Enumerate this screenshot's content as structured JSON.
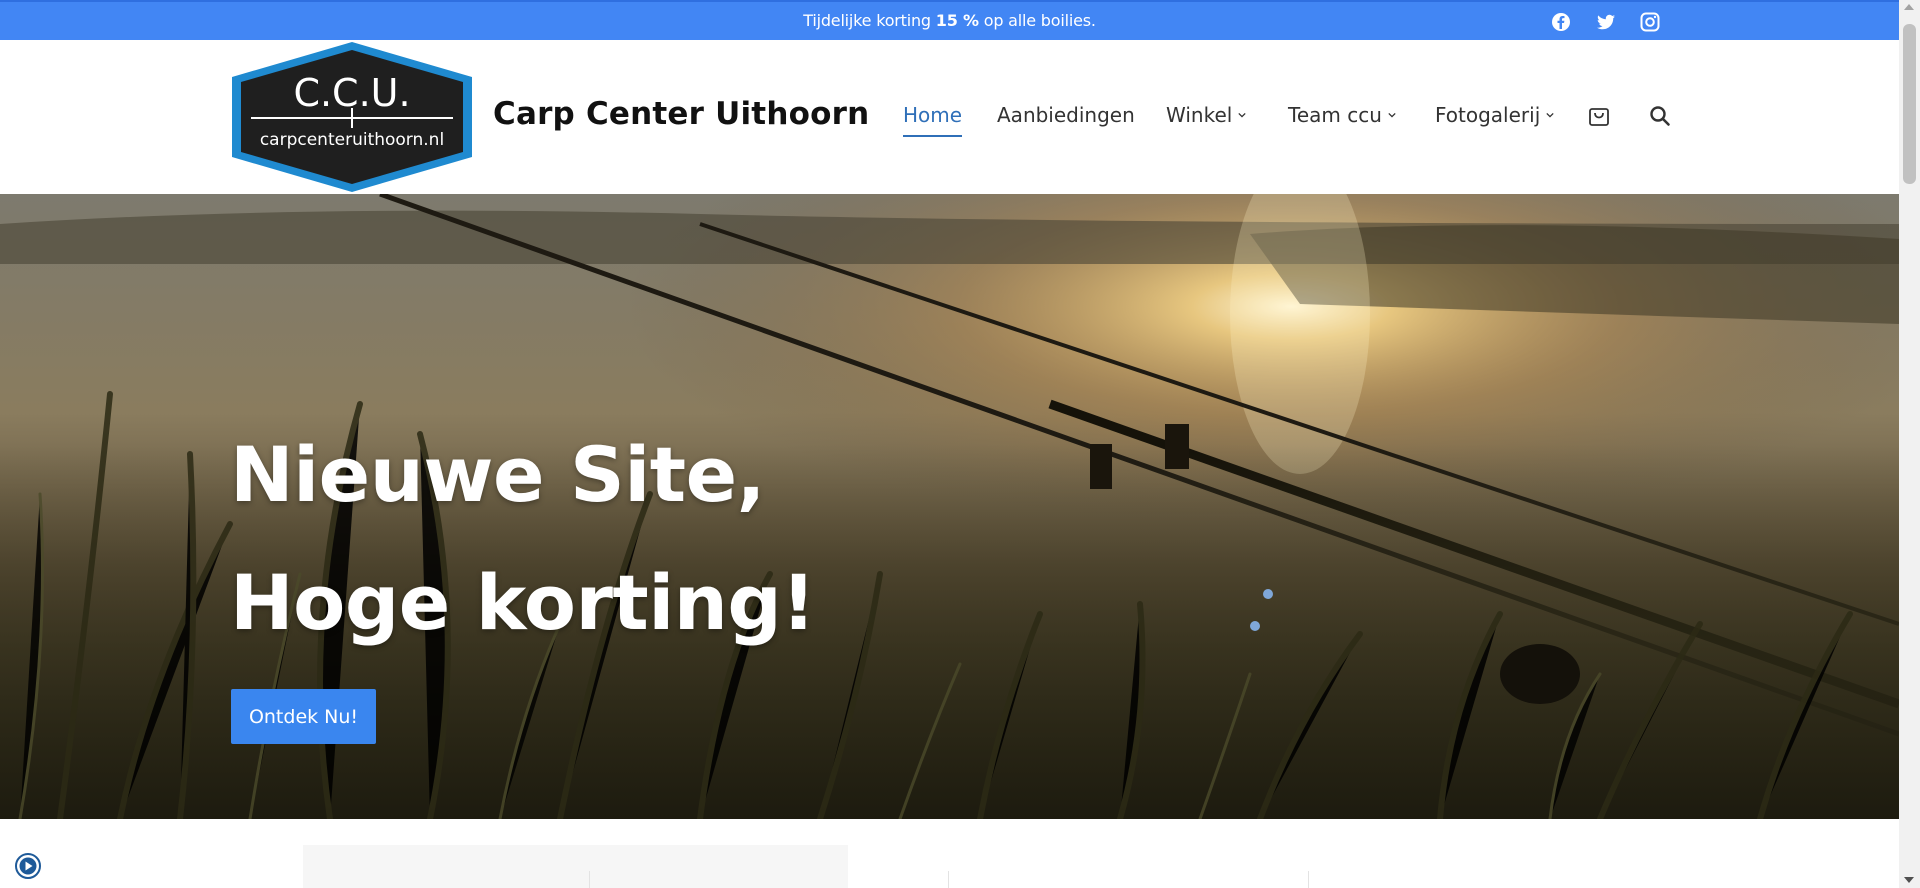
{
  "topbar": {
    "promo_before": "Tijdelijke korting ",
    "promo_bold": "15 %",
    "promo_after": " op alle boilies.",
    "social": [
      "facebook-icon",
      "twitter-icon",
      "instagram-icon"
    ]
  },
  "header": {
    "logo": {
      "line1": "C.C.U.",
      "line2": "carpcenteruithoorn.nl"
    },
    "site_title": "Carp Center Uithoorn",
    "nav": [
      {
        "label": "Home",
        "active": true
      },
      {
        "label": "Aanbiedingen"
      },
      {
        "label": "Winkel",
        "dropdown": true
      },
      {
        "label": "Team ccu",
        "dropdown": true
      },
      {
        "label": "Fotogalerij",
        "dropdown": true
      }
    ],
    "icons": [
      "shopping-bag-icon",
      "search-icon"
    ]
  },
  "hero": {
    "line1": "Nieuwe Site,",
    "line2": "Hoge korting!",
    "button": "Ontdek Nu!"
  },
  "colors": {
    "topbar": "#4286f4",
    "accent": "#2f6fb8",
    "button": "#3a86ef"
  }
}
